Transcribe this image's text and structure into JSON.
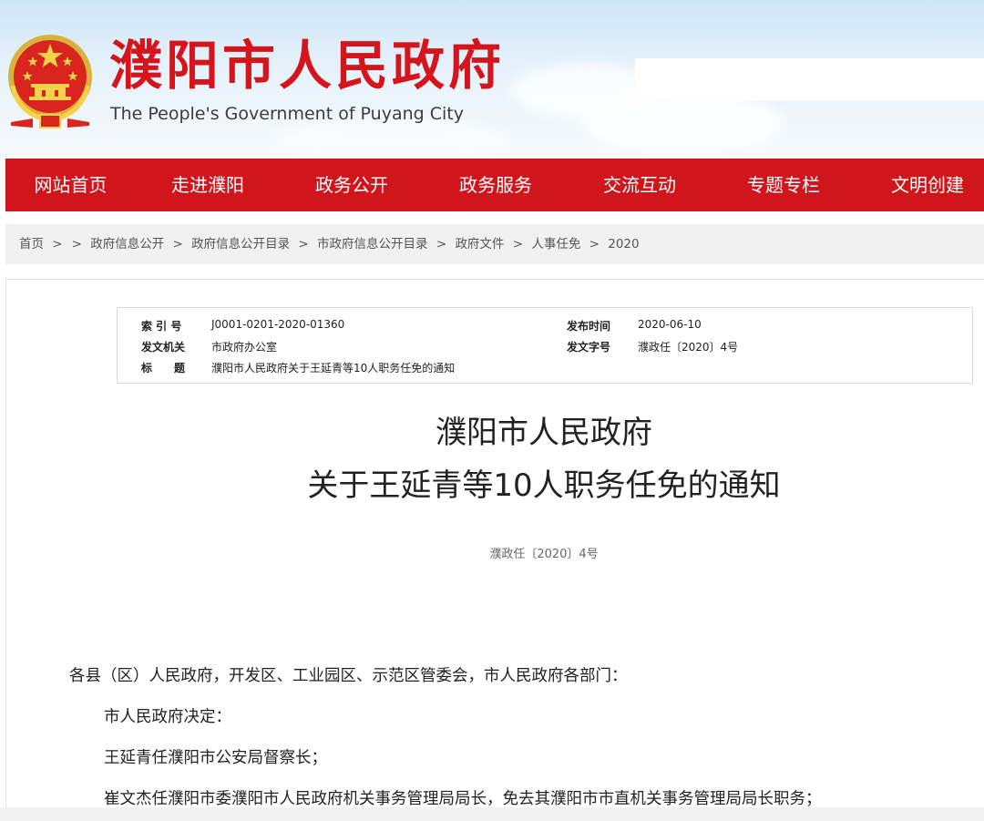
{
  "header": {
    "site_title": "濮阳市人民政府",
    "site_subtitle": "The People's Government of Puyang City",
    "search_placeholder": "",
    "brand_color": "#d0161c"
  },
  "nav": {
    "items": [
      {
        "label": "网站首页"
      },
      {
        "label": "走进濮阳"
      },
      {
        "label": "政务公开"
      },
      {
        "label": "政务服务"
      },
      {
        "label": "交流互动"
      },
      {
        "label": "专题专栏"
      },
      {
        "label": "文明创建"
      }
    ]
  },
  "breadcrumb": {
    "items": [
      "首页",
      "政府信息公开",
      "政府信息公开目录",
      "市政府信息公开目录",
      "政府文件",
      "人事任免",
      "2020"
    ],
    "separator": ">"
  },
  "metadata": {
    "index_label": "索 引 号",
    "index_value": "J0001-0201-2020-01360",
    "publish_time_label": "发布时间",
    "publish_time_value": "2020-06-10",
    "issuer_label": "发文机关",
    "issuer_value": "市政府办公室",
    "doc_no_label": "发文字号",
    "doc_no_value": "濮政任〔2020〕4号",
    "title_label": "标　　题",
    "title_value": "濮阳市人民政府关于王延青等10人职务任免的通知"
  },
  "document": {
    "title_line1": "濮阳市人民政府",
    "title_line2": "关于王延青等10人职务任免的通知",
    "doc_number": "濮政任〔2020〕4号",
    "paragraphs": [
      "各县（区）人民政府，开发区、工业园区、示范区管委会，市人民政府各部门：",
      "市人民政府决定：",
      "王延青任濮阳市公安局督察长；",
      "崔文杰任濮阳市委濮阳市人民政府机关事务管理局局长，免去其濮阳市市直机关事务管理局局长职务；"
    ]
  }
}
